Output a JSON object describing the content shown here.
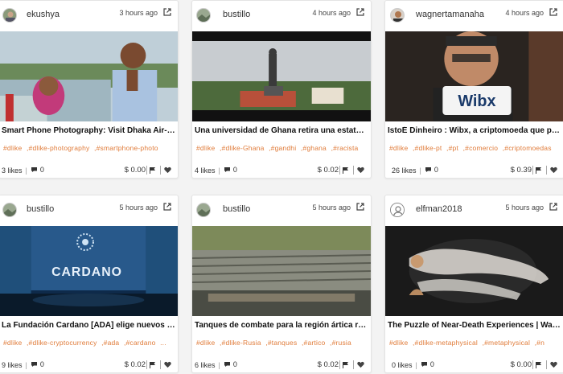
{
  "colors": {
    "tag": "#e07b39",
    "text": "#111111",
    "muted": "#444444"
  },
  "cards": [
    {
      "author": "ekushya",
      "avatar_icon": "user-photo-avatar",
      "time": "3 hours ago",
      "title": "Smart Phone Photography: Visit Dhaka Air-Force...",
      "tags": [
        "#dlike",
        ",#dlike-photography",
        ",#smartphone-photo"
      ],
      "likes": "3 likes",
      "comments": "0",
      "value": "$ 0.00"
    },
    {
      "author": "bustillo",
      "avatar_icon": "landscape-avatar",
      "time": "4 hours ago",
      "title": "Una universidad de Ghana retira una estatua de ...",
      "tags": [
        "#dlike",
        ",#dlike-Ghana",
        ",#gandhi",
        ",#ghana",
        ",#racista"
      ],
      "likes": "4 likes",
      "comments": "0",
      "value": "$ 0.02"
    },
    {
      "author": "wagnertamanaha",
      "avatar_icon": "user-photo-avatar",
      "time": "4 hours ago",
      "title": "IstoÉ Dinheiro : Wibx, a criptomoeda que promet...",
      "tags": [
        "#dlike",
        ",#dlike-pt",
        ",#pt",
        ",#comercio",
        ",#criptomoedas"
      ],
      "likes": "26 likes",
      "comments": "0",
      "value": "$ 0.39",
      "image_text": "Wibx"
    },
    {
      "author": "bustillo",
      "avatar_icon": "landscape-avatar",
      "time": "5 hours ago",
      "title": "La Fundación Cardano [ADA] elige nuevos miem...",
      "tags": [
        "#dlike",
        ",#dlike-cryptocurrency",
        ",#ada",
        ",#cardano",
        "..."
      ],
      "likes": "9 likes",
      "comments": "0",
      "value": "$ 0.02",
      "image_text": "CARDANO"
    },
    {
      "author": "bustillo",
      "avatar_icon": "landscape-avatar",
      "time": "5 hours ago",
      "title": "Tanques de combate para la región ártica rusa, p...",
      "tags": [
        "#dlike",
        ",#dlike-Rusia",
        ",#tanques",
        ",#artico",
        ",#rusia"
      ],
      "likes": "6 likes",
      "comments": "0",
      "value": "$ 0.02"
    },
    {
      "author": "elfman2018",
      "avatar_icon": "default-user-avatar",
      "time": "5 hours ago",
      "title": "The Puzzle of Near-Death Experiences | Wake Up...",
      "tags": [
        "#dlike",
        ",#dlike-metaphysical",
        ",#metaphysical",
        ",#n"
      ],
      "likes": "0 likes",
      "comments": "0",
      "value": "$ 0.00"
    }
  ]
}
